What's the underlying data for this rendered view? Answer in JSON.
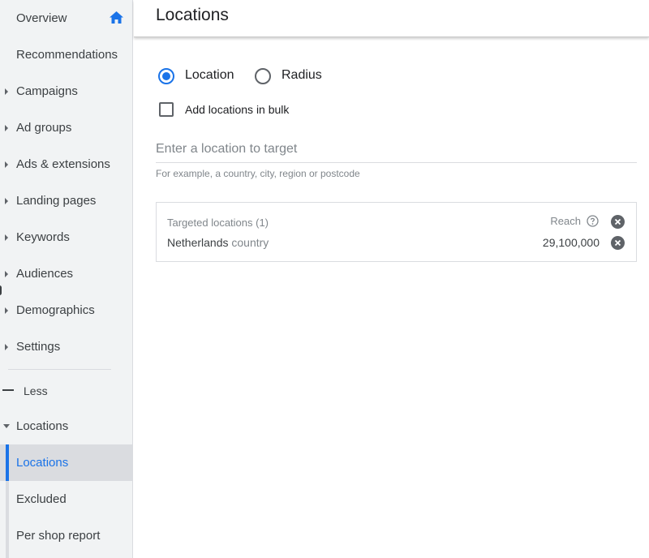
{
  "sidebar": {
    "items": [
      {
        "label": "Overview"
      },
      {
        "label": "Recommendations"
      },
      {
        "label": "Campaigns"
      },
      {
        "label": "Ad groups"
      },
      {
        "label": "Ads & extensions"
      },
      {
        "label": "Landing pages"
      },
      {
        "label": "Keywords"
      },
      {
        "label": "Audiences"
      },
      {
        "label": "Demographics"
      },
      {
        "label": "Settings"
      }
    ],
    "less_label": "Less",
    "locations_group": {
      "label": "Locations",
      "children": [
        {
          "label": "Locations",
          "active": true
        },
        {
          "label": "Excluded"
        },
        {
          "label": "Per shop report"
        }
      ]
    }
  },
  "header": {
    "title": "Locations"
  },
  "targeting": {
    "options": [
      {
        "label": "Location",
        "selected": true
      },
      {
        "label": "Radius",
        "selected": false
      }
    ],
    "bulk_label": "Add locations in bulk",
    "input_placeholder": "Enter a location to target",
    "hint": "For example, a country, city, region or postcode"
  },
  "targeted": {
    "header": "Targeted locations (1)",
    "reach_label": "Reach",
    "rows": [
      {
        "name": "Netherlands",
        "type": "country",
        "reach": "29,100,000"
      }
    ]
  },
  "colors": {
    "accent": "#1a73e8",
    "sidebar_bg": "#f1f3f4",
    "active_bg": "#dadce0",
    "text": "#202124",
    "muted": "#80868b"
  }
}
